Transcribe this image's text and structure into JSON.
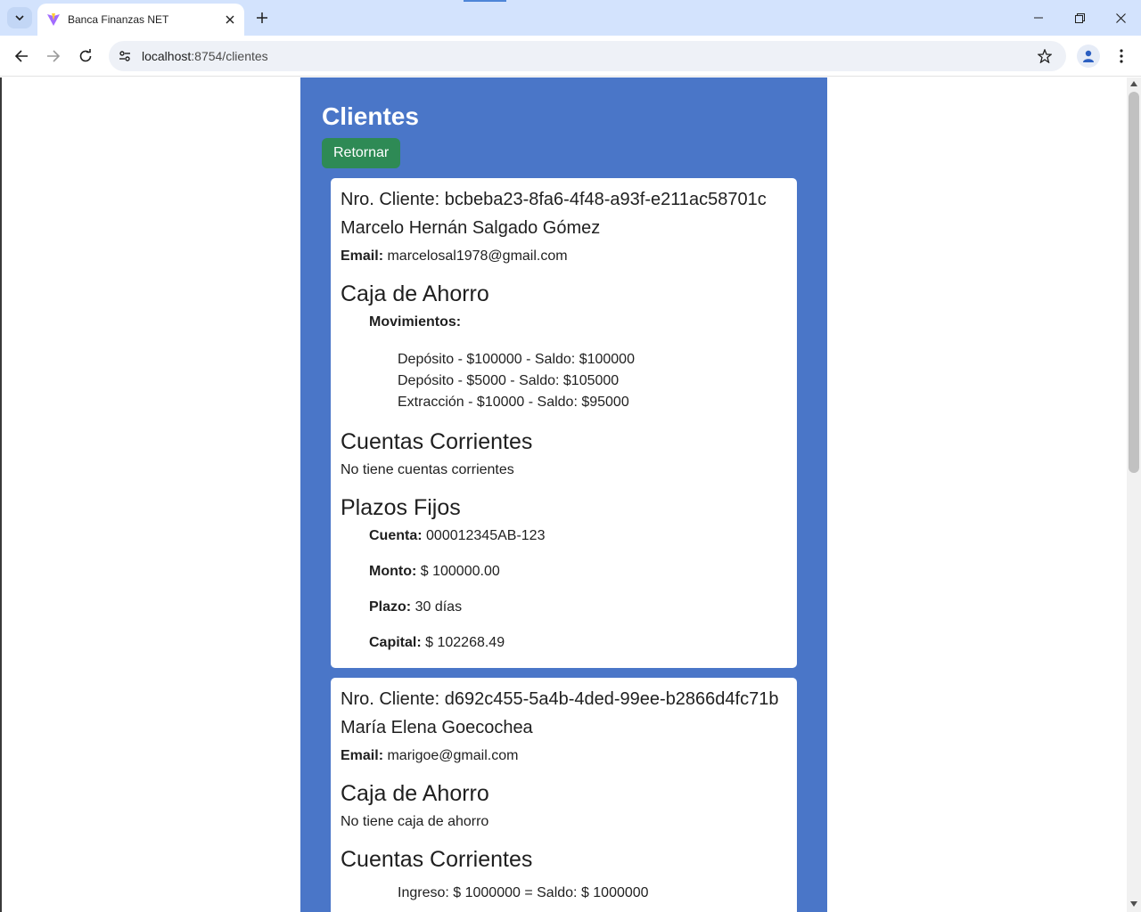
{
  "browser": {
    "tab_title": "Banca Finanzas NET",
    "url_host": "localhost",
    "url_rest": ":8754/clientes"
  },
  "page": {
    "title": "Clientes",
    "return_label": "Retornar"
  },
  "clients": [
    {
      "id_label": "Nro. Cliente: bcbeba23-8fa6-4f48-a93f-e211ac58701c",
      "name": "Marcelo Hernán Salgado Gómez",
      "email_label": "Email:",
      "email": "marcelosal1978@gmail.com",
      "savings_title": "Caja de Ahorro",
      "movements_label": "Movimientos:",
      "movements": [
        "Depósito - $100000 - Saldo: $100000",
        "Depósito - $5000 - Saldo: $105000",
        "Extracción - $10000 - Saldo: $95000"
      ],
      "checking_title": "Cuentas Corrientes",
      "checking_empty": "No tiene cuentas corrientes",
      "fixed_title": "Plazos Fijos",
      "fixed": {
        "account_label": "Cuenta:",
        "account": "000012345AB-123",
        "amount_label": "Monto:",
        "amount": "$ 100000.00",
        "term_label": "Plazo:",
        "term": "30 días",
        "capital_label": "Capital:",
        "capital": "$ 102268.49"
      }
    },
    {
      "id_label": "Nro. Cliente: d692c455-5a4b-4ded-99ee-b2866d4fc71b",
      "name": "María Elena Goecochea",
      "email_label": "Email:",
      "email": "marigoe@gmail.com",
      "savings_title": "Caja de Ahorro",
      "savings_empty": "No tiene caja de ahorro",
      "checking_title": "Cuentas Corrientes",
      "checking_movements": [
        "Ingreso: $ 1000000 = Saldo: $ 1000000"
      ]
    }
  ]
}
